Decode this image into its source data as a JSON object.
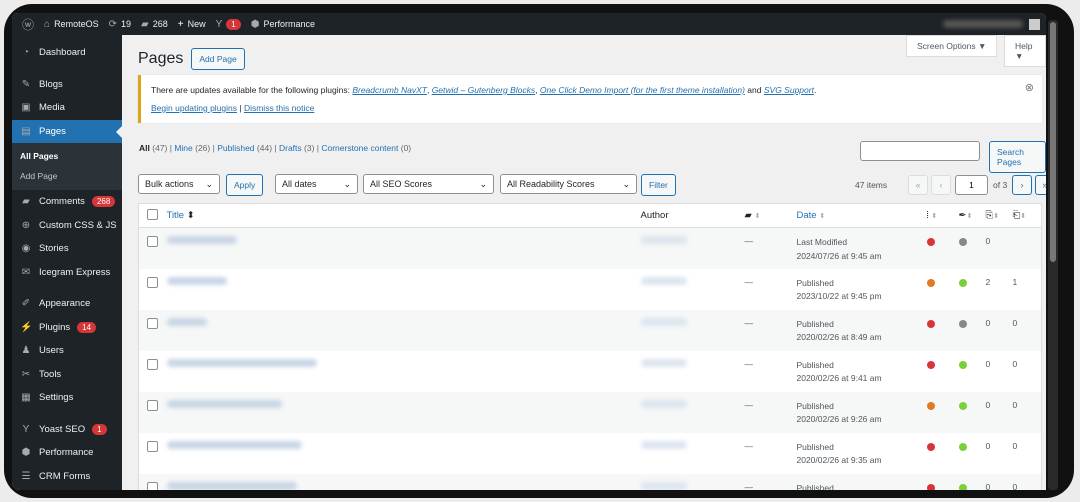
{
  "adminbar": {
    "site": "RemoteOS",
    "updates": "19",
    "comments": "268",
    "new": "New",
    "yoast_badge": "1",
    "performance": "Performance"
  },
  "sidebar": {
    "items": [
      {
        "label": "Dashboard",
        "icon": "dashboard-icon"
      },
      {
        "label": "Blogs",
        "icon": "pin-icon"
      },
      {
        "label": "Media",
        "icon": "media-icon"
      },
      {
        "label": "Pages",
        "icon": "pages-icon"
      },
      {
        "label": "Comments",
        "icon": "comment-icon",
        "badge": "268"
      },
      {
        "label": "Custom CSS & JS",
        "icon": "plus-circle-icon"
      },
      {
        "label": "Stories",
        "icon": "stories-icon"
      },
      {
        "label": "Icegram Express",
        "icon": "mail-icon"
      },
      {
        "label": "Appearance",
        "icon": "brush-icon"
      },
      {
        "label": "Plugins",
        "icon": "plugin-icon",
        "badge": "14"
      },
      {
        "label": "Users",
        "icon": "user-icon"
      },
      {
        "label": "Tools",
        "icon": "wrench-icon"
      },
      {
        "label": "Settings",
        "icon": "settings-icon"
      },
      {
        "label": "Yoast SEO",
        "icon": "yoast-icon",
        "badge": "1"
      },
      {
        "label": "Performance",
        "icon": "performance-icon"
      },
      {
        "label": "CRM Forms",
        "icon": "forms-icon"
      }
    ],
    "submenu": [
      "All Pages",
      "Add Page"
    ]
  },
  "header": {
    "title": "Pages",
    "add": "Add Page",
    "screen_options": "Screen Options ▼",
    "help": "Help ▼"
  },
  "notice": {
    "text": "There are updates available for the following plugins:",
    "plugins": [
      "Breadcrumb NavXT",
      "Getwid – Gutenberg Blocks",
      "One Click Demo Import (for the first theme installation)",
      "SVG Support"
    ],
    "and": "and",
    "begin": "Begin updating plugins",
    "dismiss": "Dismiss this notice"
  },
  "views": [
    {
      "label": "All",
      "count": "(47)"
    },
    {
      "label": "Mine",
      "count": "(26)"
    },
    {
      "label": "Published",
      "count": "(44)"
    },
    {
      "label": "Drafts",
      "count": "(3)"
    },
    {
      "label": "Cornerstone content",
      "count": "(0)"
    }
  ],
  "filters": {
    "bulk": "Bulk actions",
    "apply": "Apply",
    "dates": "All dates",
    "seo": "All SEO Scores",
    "readability": "All Readability Scores",
    "filter": "Filter",
    "search_button": "Search Pages",
    "search_value": ""
  },
  "pagination": {
    "items": "47 items",
    "first": "«",
    "prev": "‹",
    "page": "1",
    "of": "of 3",
    "next": "›",
    "last": "»"
  },
  "columns": {
    "title": "Title",
    "author": "Author",
    "date": "Date"
  },
  "colors": {
    "red": "#d63638",
    "orange": "#e07b24",
    "green": "#7ad03a",
    "gray": "#888888"
  },
  "rows": [
    {
      "status": "Last Modified",
      "date": "2024/07/26 at 9:45 am",
      "comments": "—",
      "seo": "red",
      "read": "gray",
      "links": "0",
      "linked": ""
    },
    {
      "status": "Published",
      "date": "2023/10/22 at 9:45 pm",
      "comments": "—",
      "seo": "orange",
      "read": "green",
      "links": "2",
      "linked": "1"
    },
    {
      "status": "Published",
      "date": "2020/02/26 at 8:49 am",
      "comments": "—",
      "seo": "red",
      "read": "gray",
      "links": "0",
      "linked": "0"
    },
    {
      "status": "Published",
      "date": "2020/02/26 at 9:41 am",
      "comments": "—",
      "seo": "red",
      "read": "green",
      "links": "0",
      "linked": "0"
    },
    {
      "status": "Published",
      "date": "2020/02/26 at 9:26 am",
      "comments": "—",
      "seo": "orange",
      "read": "green",
      "links": "0",
      "linked": "0"
    },
    {
      "status": "Published",
      "date": "2020/02/26 at 9:35 am",
      "comments": "—",
      "seo": "red",
      "read": "green",
      "links": "0",
      "linked": "0"
    },
    {
      "status": "Published",
      "date": "",
      "comments": "—",
      "seo": "red",
      "read": "green",
      "links": "0",
      "linked": "0"
    }
  ]
}
